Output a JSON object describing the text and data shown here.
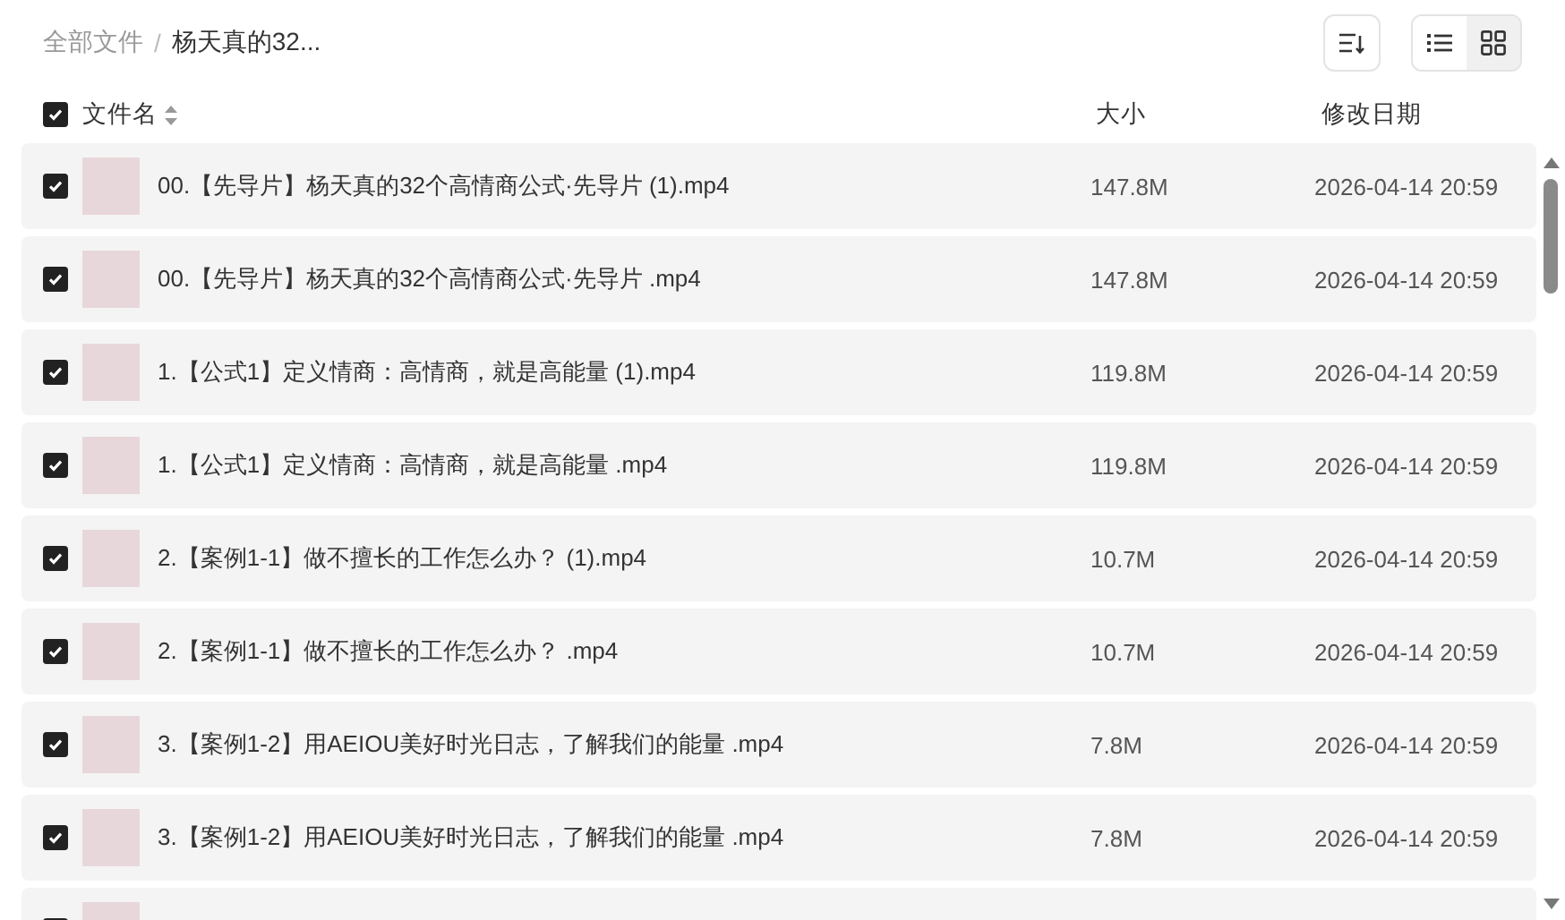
{
  "breadcrumb": {
    "separator": "/",
    "items": [
      {
        "label": "全部文件",
        "current": false
      },
      {
        "label": "杨天真的32...",
        "current": true
      }
    ]
  },
  "toolbar": {
    "view_modes": [
      {
        "kind": "list",
        "selected": false
      },
      {
        "kind": "grid",
        "selected": true
      }
    ]
  },
  "table": {
    "select_all": {
      "checked": true
    },
    "columns": [
      {
        "label": "文件名",
        "sortable": true
      },
      {
        "label": "大小",
        "sortable": false
      },
      {
        "label": "修改日期",
        "sortable": false
      }
    ],
    "rows": [
      {
        "checked": true,
        "name": "00.【先导片】杨天真的32个高情商公式·先导片 (1).mp4",
        "size": "147.8M",
        "modified": "2026-04-14 20:59"
      },
      {
        "checked": true,
        "name": "00.【先导片】杨天真的32个高情商公式·先导片 .mp4",
        "size": "147.8M",
        "modified": "2026-04-14 20:59"
      },
      {
        "checked": true,
        "name": "1.【公式1】定义情商：高情商，就是高能量 (1).mp4",
        "size": "119.8M",
        "modified": "2026-04-14 20:59"
      },
      {
        "checked": true,
        "name": "1.【公式1】定义情商：高情商，就是高能量 .mp4",
        "size": "119.8M",
        "modified": "2026-04-14 20:59"
      },
      {
        "checked": true,
        "name": "2.【案例1-1】做不擅长的工作怎么办？ (1).mp4",
        "size": "10.7M",
        "modified": "2026-04-14 20:59"
      },
      {
        "checked": true,
        "name": "2.【案例1-1】做不擅长的工作怎么办？ .mp4",
        "size": "10.7M",
        "modified": "2026-04-14 20:59"
      },
      {
        "checked": true,
        "name": "3.【案例1-2】用AEIOU美好时光日志，了解我们的能量 .mp4",
        "size": "7.8M",
        "modified": "2026-04-14 20:59"
      },
      {
        "checked": true,
        "name": "3.【案例1-2】用AEIOU美好时光日志，了解我们的能量 .mp4",
        "size": "7.8M",
        "modified": "2026-04-14 20:59"
      },
      {
        "checked": true
      }
    ]
  }
}
